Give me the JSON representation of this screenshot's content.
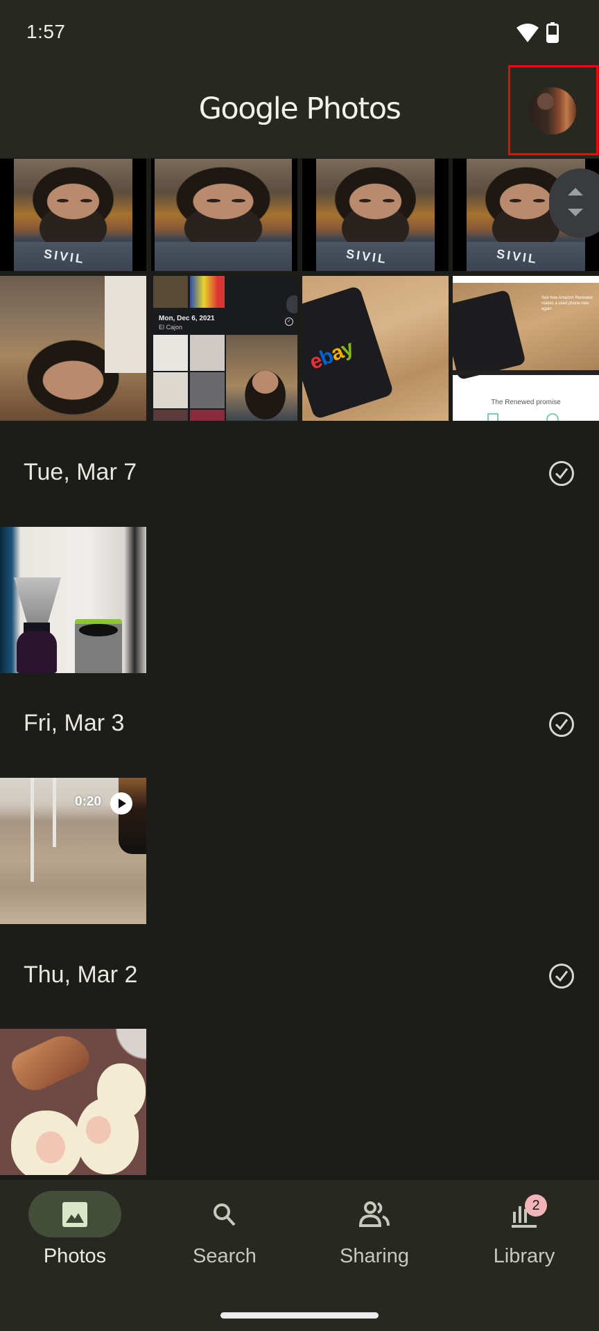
{
  "status_bar": {
    "time": "1:57",
    "icons": [
      "wifi-icon",
      "battery-icon"
    ]
  },
  "header": {
    "title_google": "Google",
    "title_photos": "Photos",
    "avatar": "account-avatar",
    "avatar_highlight_color": "#ff0000"
  },
  "grid": {
    "top_row": [
      {
        "type": "selfie",
        "caption": "SIVIL"
      },
      {
        "type": "selfie",
        "caption": ""
      },
      {
        "type": "selfie",
        "caption": "SIVIL"
      },
      {
        "type": "selfie",
        "caption": "SIVIL"
      }
    ],
    "second_row": [
      {
        "type": "selfie"
      },
      {
        "type": "screenshot-collage",
        "date": "Mon, Dec 6, 2021",
        "place": "El Cajon"
      },
      {
        "type": "ebay-photo",
        "logo": "ebay"
      },
      {
        "type": "screenshot",
        "caption": "See how Amazon Renewed makes a used phone new again",
        "heading": "The Renewed promise"
      }
    ]
  },
  "fast_scroll": {
    "icon": "fast-scroll-handle"
  },
  "sections": [
    {
      "date": "Tue, Mar 7",
      "items": [
        {
          "type": "photo",
          "subject": "coffee"
        }
      ]
    },
    {
      "date": "Fri, Mar 3",
      "items": [
        {
          "type": "video",
          "duration": "0:20"
        }
      ]
    },
    {
      "date": "Thu, Mar 2",
      "items": [
        {
          "type": "photo",
          "subject": "eggs"
        }
      ]
    }
  ],
  "ebay_colors": [
    "#e53238",
    "#0064d2",
    "#f5af02",
    "#86b817"
  ],
  "bottom_nav": {
    "items": [
      {
        "label": "Photos",
        "icon": "photos-icon",
        "active": true
      },
      {
        "label": "Search",
        "icon": "search-icon",
        "active": false
      },
      {
        "label": "Sharing",
        "icon": "sharing-icon",
        "active": false
      },
      {
        "label": "Library",
        "icon": "library-icon",
        "active": false,
        "badge": "2"
      }
    ],
    "active_pill_color": "#444d38",
    "badge_color": "#f2b5b7"
  }
}
